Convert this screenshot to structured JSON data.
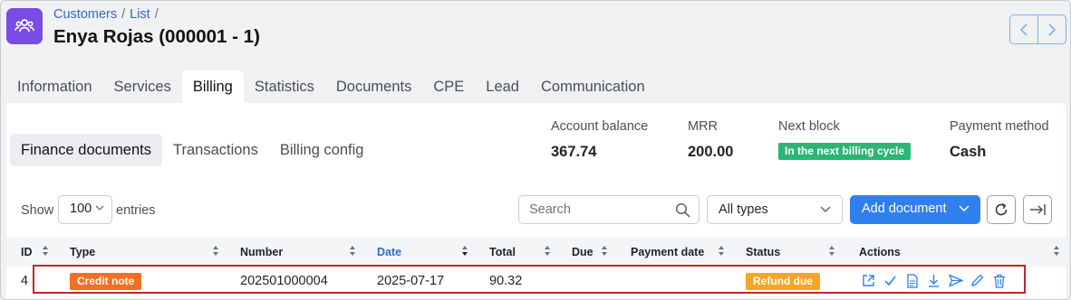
{
  "breadcrumb": [
    "Customers",
    "List"
  ],
  "page_title": "Enya Rojas (000001 - 1)",
  "main_tabs": [
    {
      "label": "Information"
    },
    {
      "label": "Services"
    },
    {
      "label": "Billing"
    },
    {
      "label": "Statistics"
    },
    {
      "label": "Documents"
    },
    {
      "label": "CPE"
    },
    {
      "label": "Lead"
    },
    {
      "label": "Communication"
    }
  ],
  "sub_tabs": [
    {
      "label": "Finance documents"
    },
    {
      "label": "Transactions"
    },
    {
      "label": "Billing config"
    }
  ],
  "summary": {
    "account_balance_label": "Account balance",
    "account_balance_value": "367.74",
    "mrr_label": "MRR",
    "mrr_value": "200.00",
    "next_block_label": "Next block",
    "next_block_value": "In the next billing cycle",
    "payment_method_label": "Payment method",
    "payment_method_value": "Cash"
  },
  "toolbar": {
    "show_label": "Show",
    "entries_value": "100",
    "entries_label": "entries",
    "search_placeholder": "Search",
    "type_filter": "All types",
    "add_document_label": "Add document"
  },
  "table": {
    "columns": [
      "ID",
      "Type",
      "Number",
      "Date",
      "Total",
      "Due",
      "Payment date",
      "Status",
      "Actions"
    ],
    "rows": [
      {
        "id": "4",
        "type": "Credit note",
        "number": "202501000004",
        "date": "2025-07-17",
        "total": "90.32",
        "due": "",
        "payment_date": "",
        "status": "Refund due"
      }
    ]
  },
  "colors": {
    "accent": "#2f80ed",
    "app_icon": "#7a4be5",
    "badge_next_block": "#2bb673",
    "badge_credit_note": "#f36f21",
    "badge_refund_due": "#f5a623",
    "highlight_border": "#c0282d"
  }
}
